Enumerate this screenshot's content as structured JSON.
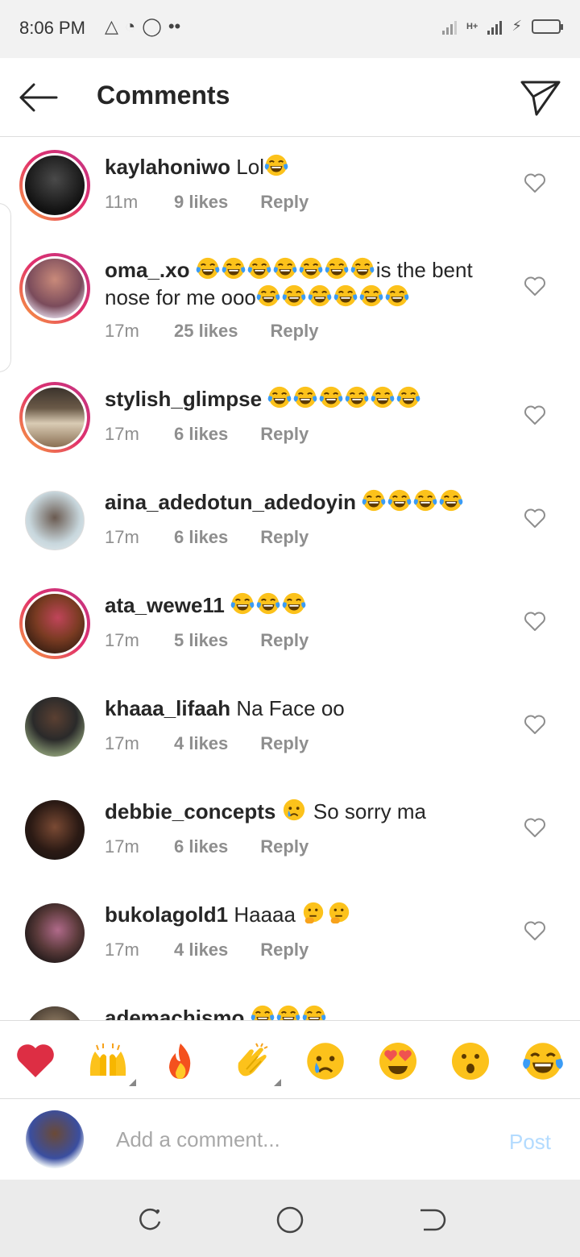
{
  "status_bar": {
    "time": "8:06 PM",
    "network": "H+"
  },
  "header": {
    "title": "Comments"
  },
  "comments": [
    {
      "username": "kaylahoniwo",
      "text": "Lol",
      "emojis": 1,
      "time": "11m",
      "likes": "9 likes",
      "reply": "Reply"
    },
    {
      "username": "oma_.xo",
      "text_pre_emojis": 7,
      "text": "is the bent nose for me ooo",
      "emojis": 6,
      "time": "17m",
      "likes": "25 likes",
      "reply": "Reply"
    },
    {
      "username": "stylish_glimpse",
      "text": "",
      "emojis": 6,
      "time": "17m",
      "likes": "6 likes",
      "reply": "Reply"
    },
    {
      "username": "aina_adedotun_adedoyin",
      "text": "",
      "emojis": 4,
      "time": "17m",
      "likes": "6 likes",
      "reply": "Reply"
    },
    {
      "username": "ata_wewe11",
      "text": "",
      "emojis": 3,
      "time": "17m",
      "likes": "5 likes",
      "reply": "Reply"
    },
    {
      "username": "khaaa_lifaah",
      "text": "Na Face oo",
      "time": "17m",
      "likes": "4 likes",
      "reply": "Reply"
    },
    {
      "username": "debbie_concepts",
      "text": "So sorry ma",
      "emoji": "crying-face",
      "time": "17m",
      "likes": "6 likes",
      "reply": "Reply"
    },
    {
      "username": "bukolagold1",
      "text": "Haaaa",
      "emoji": "thinking-face",
      "emojis": 2,
      "time": "17m",
      "likes": "4 likes",
      "reply": "Reply"
    },
    {
      "username": "ademachismo",
      "emojis": 3
    }
  ],
  "quick_emojis": [
    "red-heart",
    "raising-hands",
    "fire",
    "clapping-hands",
    "crying-face",
    "heart-eyes",
    "astonished-face",
    "tears-of-joy"
  ],
  "composer": {
    "placeholder": "Add a comment...",
    "post_label": "Post"
  },
  "colors": {
    "accent": "#0095f6",
    "post_disabled": "#b3dbff",
    "story_ring_start": "#f9a33b",
    "story_ring_end": "#c13584"
  }
}
